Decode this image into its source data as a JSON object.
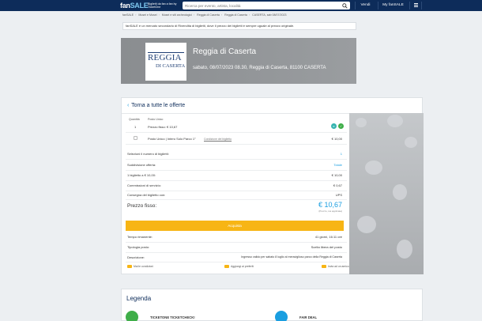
{
  "header": {
    "logo_fan": "fan",
    "logo_sale": "SALE",
    "tagline": "Biglietti da fan a fan by TicketOne",
    "search_placeholder": "Ricerca per evento, artista, località",
    "sell_label": "Vendi",
    "my_label": "My fanSALE",
    "menu_label": "Menu"
  },
  "breadcrumb": [
    "fanSALE",
    "Musei e Musei",
    "Musei e siti archeologici",
    "Reggia di Caserta",
    "Reggia di Caserta",
    "CASERTA, sab 08/07/2023"
  ],
  "notice": "fanSALE è un mercato secondario di Rivendita di biglietti, dove il prezzo dei biglietti è sempre uguale al prezzo originale.",
  "event": {
    "logo_line1": "REGGIA",
    "logo_line2": "DI CASERTA",
    "title": "Reggia di Caserta",
    "subtitle": "sabato, 08/07/2023 08.30, Reggia di Caserta, 81100 CASERTA"
  },
  "offer": {
    "back_label": "Torna a tutte le offerte",
    "col_quantity": "Quantità",
    "col_seat": "Posto Unico",
    "qty": "1",
    "fixed_price_line": "Prezzo fisso: € 10,67",
    "badge_teal": "e",
    "badge_green": "✓",
    "ticket_desc": "Posto Unico | Intero Solo Parco 1°",
    "ticket_link": "Condizione del biglietto",
    "ticket_price": "€ 10,00",
    "rows": [
      {
        "label": "Selezioni il numero di biglietti:",
        "value": "1"
      },
      {
        "label": "Suddivisione offerta:",
        "value": "Totale"
      },
      {
        "label": "1 biglietto a € 10,00:",
        "value": "€ 10,00"
      },
      {
        "label": "Commissioni di servizio:",
        "value": "€ 0,67"
      },
      {
        "label": "Consegna del biglietto con:",
        "value": "UPS"
      }
    ],
    "price_label": "Prezzo fisso:",
    "price_value": "€ 10,67",
    "price_note": "(Prezzo, iva applicata)",
    "buy_label": "Acquista",
    "info": [
      {
        "label": "Tempo rimanente:",
        "value": "41 giorni, 16:11 ore"
      },
      {
        "label": "Tipologia posto:",
        "value": "Scelta libera del posto"
      },
      {
        "label": "Descrizione:",
        "value": "Ingresso valido per sabato 8 luglio al meraviglioso parco della Reggia di Caserta"
      }
    ],
    "footer_icons": [
      "Mai le condizioni",
      "Aggiungi ai preferiti",
      "Invia ad un amico"
    ]
  },
  "legend": {
    "title": "Legenda",
    "items": [
      {
        "label": "TICKETONE TICKETCHECK!",
        "color": "#3fae49"
      },
      {
        "label": "FAIR DEAL",
        "color": "#1a9ee0"
      }
    ]
  },
  "colors": {
    "navy": "#0d2c5a",
    "accent_blue": "#1a9ee0",
    "buy_yellow": "#f7b515"
  }
}
